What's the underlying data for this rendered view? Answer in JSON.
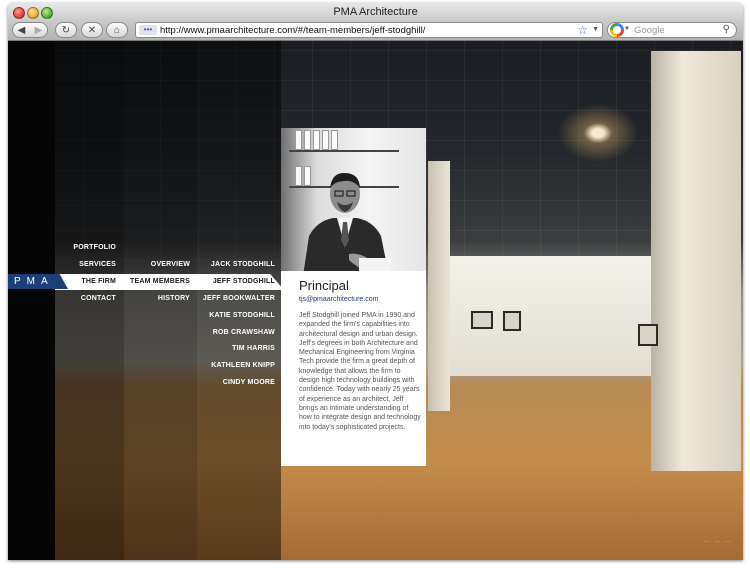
{
  "window": {
    "title": "PMA Architecture"
  },
  "toolbar": {
    "url": "http://www.pmaarchitecture.com/#/team-members/jeff-stodghill/",
    "search_placeholder": "Google",
    "back_glyph": "◀",
    "forward_glyph": "▶",
    "reload_glyph": "↻",
    "stop_glyph": "✕",
    "home_glyph": "⌂"
  },
  "site": {
    "logo": "PMA",
    "brand_color": "#1c3f7a",
    "nav_main": [
      "PORTFOLIO",
      "SERVICES",
      "THE FIRM",
      "CONTACT"
    ],
    "nav_firm": [
      "OVERVIEW",
      "TEAM MEMBERS",
      "HISTORY"
    ],
    "nav_team": [
      "JACK STODGHILL",
      "JEFF STODGHILL",
      "JEFF BOOKWALTER",
      "KATIE STODGHILL",
      "ROB CRAWSHAW",
      "TIM HARRIS",
      "KATHLEEN KNIPP",
      "CINDY MOORE"
    ]
  },
  "profile": {
    "title": "Principal",
    "email": "tjs@pmaarchitecture.com",
    "bio": "Jeff Stodghill joined PMA in 1990 and expanded the firm's capabilities into architectural design and urban design. Jeff's degrees in both Architecture and Mechanical Engineering from Virginia Tech provide the firm a great depth of knowledge that allows the firm to design high technology buildings with confidence. Today with nearly 25 years of experience as an architect, Jeff brings an intimate understanding of how to integrate design and technology into today's sophisticated projects."
  }
}
